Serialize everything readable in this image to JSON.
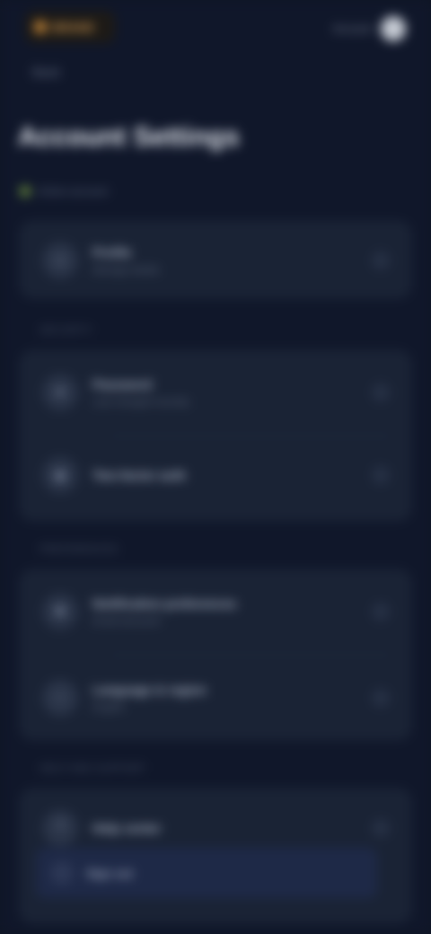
{
  "app": {
    "logo_text": "BRAND",
    "top_label": "Account",
    "back_label": "Back",
    "title": "Account Settings",
    "status_text": "Active account",
    "accent": "#c8893a",
    "status_color": "#6a8d3c"
  },
  "sections": {
    "profile": {
      "rows": [
        {
          "title": "Profile",
          "sub": "Manage details",
          "icon": "user-icon"
        }
      ]
    },
    "security": {
      "label": "SECURITY",
      "rows": [
        {
          "title": "Password",
          "sub": "Last changed recently",
          "icon": "lock-icon"
        },
        {
          "title": "Two-factor auth",
          "sub": "",
          "icon": "shield-icon"
        }
      ]
    },
    "preferences": {
      "label": "PREFERENCES",
      "rows": [
        {
          "title": "Notification preferences",
          "sub": "Email and push",
          "icon": "bell-icon"
        },
        {
          "title": "Language & region",
          "sub": "English",
          "icon": "globe-icon"
        }
      ]
    },
    "support": {
      "label": "HELP AND SUPPORT",
      "rows": [
        {
          "title": "Help center",
          "sub": "",
          "icon": "help-icon"
        }
      ],
      "highlight": {
        "label": "Sign out",
        "icon": "logout-icon"
      }
    }
  }
}
